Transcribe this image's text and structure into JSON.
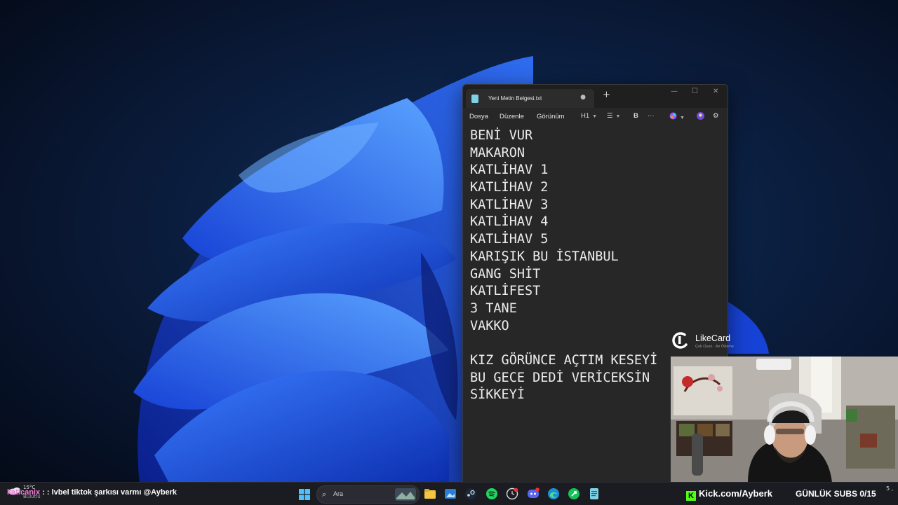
{
  "notepad": {
    "tab_title": "Yeni Metin Belgesi.txt",
    "menu": [
      "Dosya",
      "Düzenle",
      "Görünüm"
    ],
    "heading_tool": "H1",
    "bold_tool": "B",
    "more_tool": "···",
    "lines": [
      "BENİ VUR",
      "MAKARON",
      "KATLİHAV 1",
      "KATLİHAV 2",
      "KATLİHAV 3",
      "KATLİHAV 4",
      "KATLİHAV 5",
      "KARIŞIK BU İSTANBUL",
      "GANG SHİT",
      "KATLİFEST",
      "3 TANE",
      "VAKKO",
      "",
      "KIZ GÖRÜNCE AÇTIM KESEYİ",
      "BU GECE DEDİ VERİCEKSİN",
      "SİKKEYİ"
    ]
  },
  "likecard": {
    "title": "LikeCard",
    "subtitle": "Çok Oyun · Az Ödeme"
  },
  "taskbar": {
    "weather_temp": "15°C",
    "weather_desc": "Bulutlu",
    "chat_user": "katlcanix",
    "chat_message": ": : lvbel tiktok şarkısı varmı @Ayberk",
    "search_placeholder": "Ara",
    "kick_text": "Kick.com/Ayberk",
    "subs_text": "GÜNLÜK SUBS 0/15",
    "clock_fragment": "5 ,"
  },
  "icons": {
    "start": "windows-start-icon",
    "search": "search-icon",
    "apps": [
      "file-explorer-icon",
      "photos-icon",
      "steam-icon",
      "spotify-icon",
      "clock-app-icon",
      "discord-icon",
      "edge-icon",
      "game-app-icon",
      "notepad-icon"
    ]
  },
  "colors": {
    "accent_blue": "#2f6cf0",
    "kick_green": "#53fc18",
    "chat_user": "#f07bd4"
  }
}
